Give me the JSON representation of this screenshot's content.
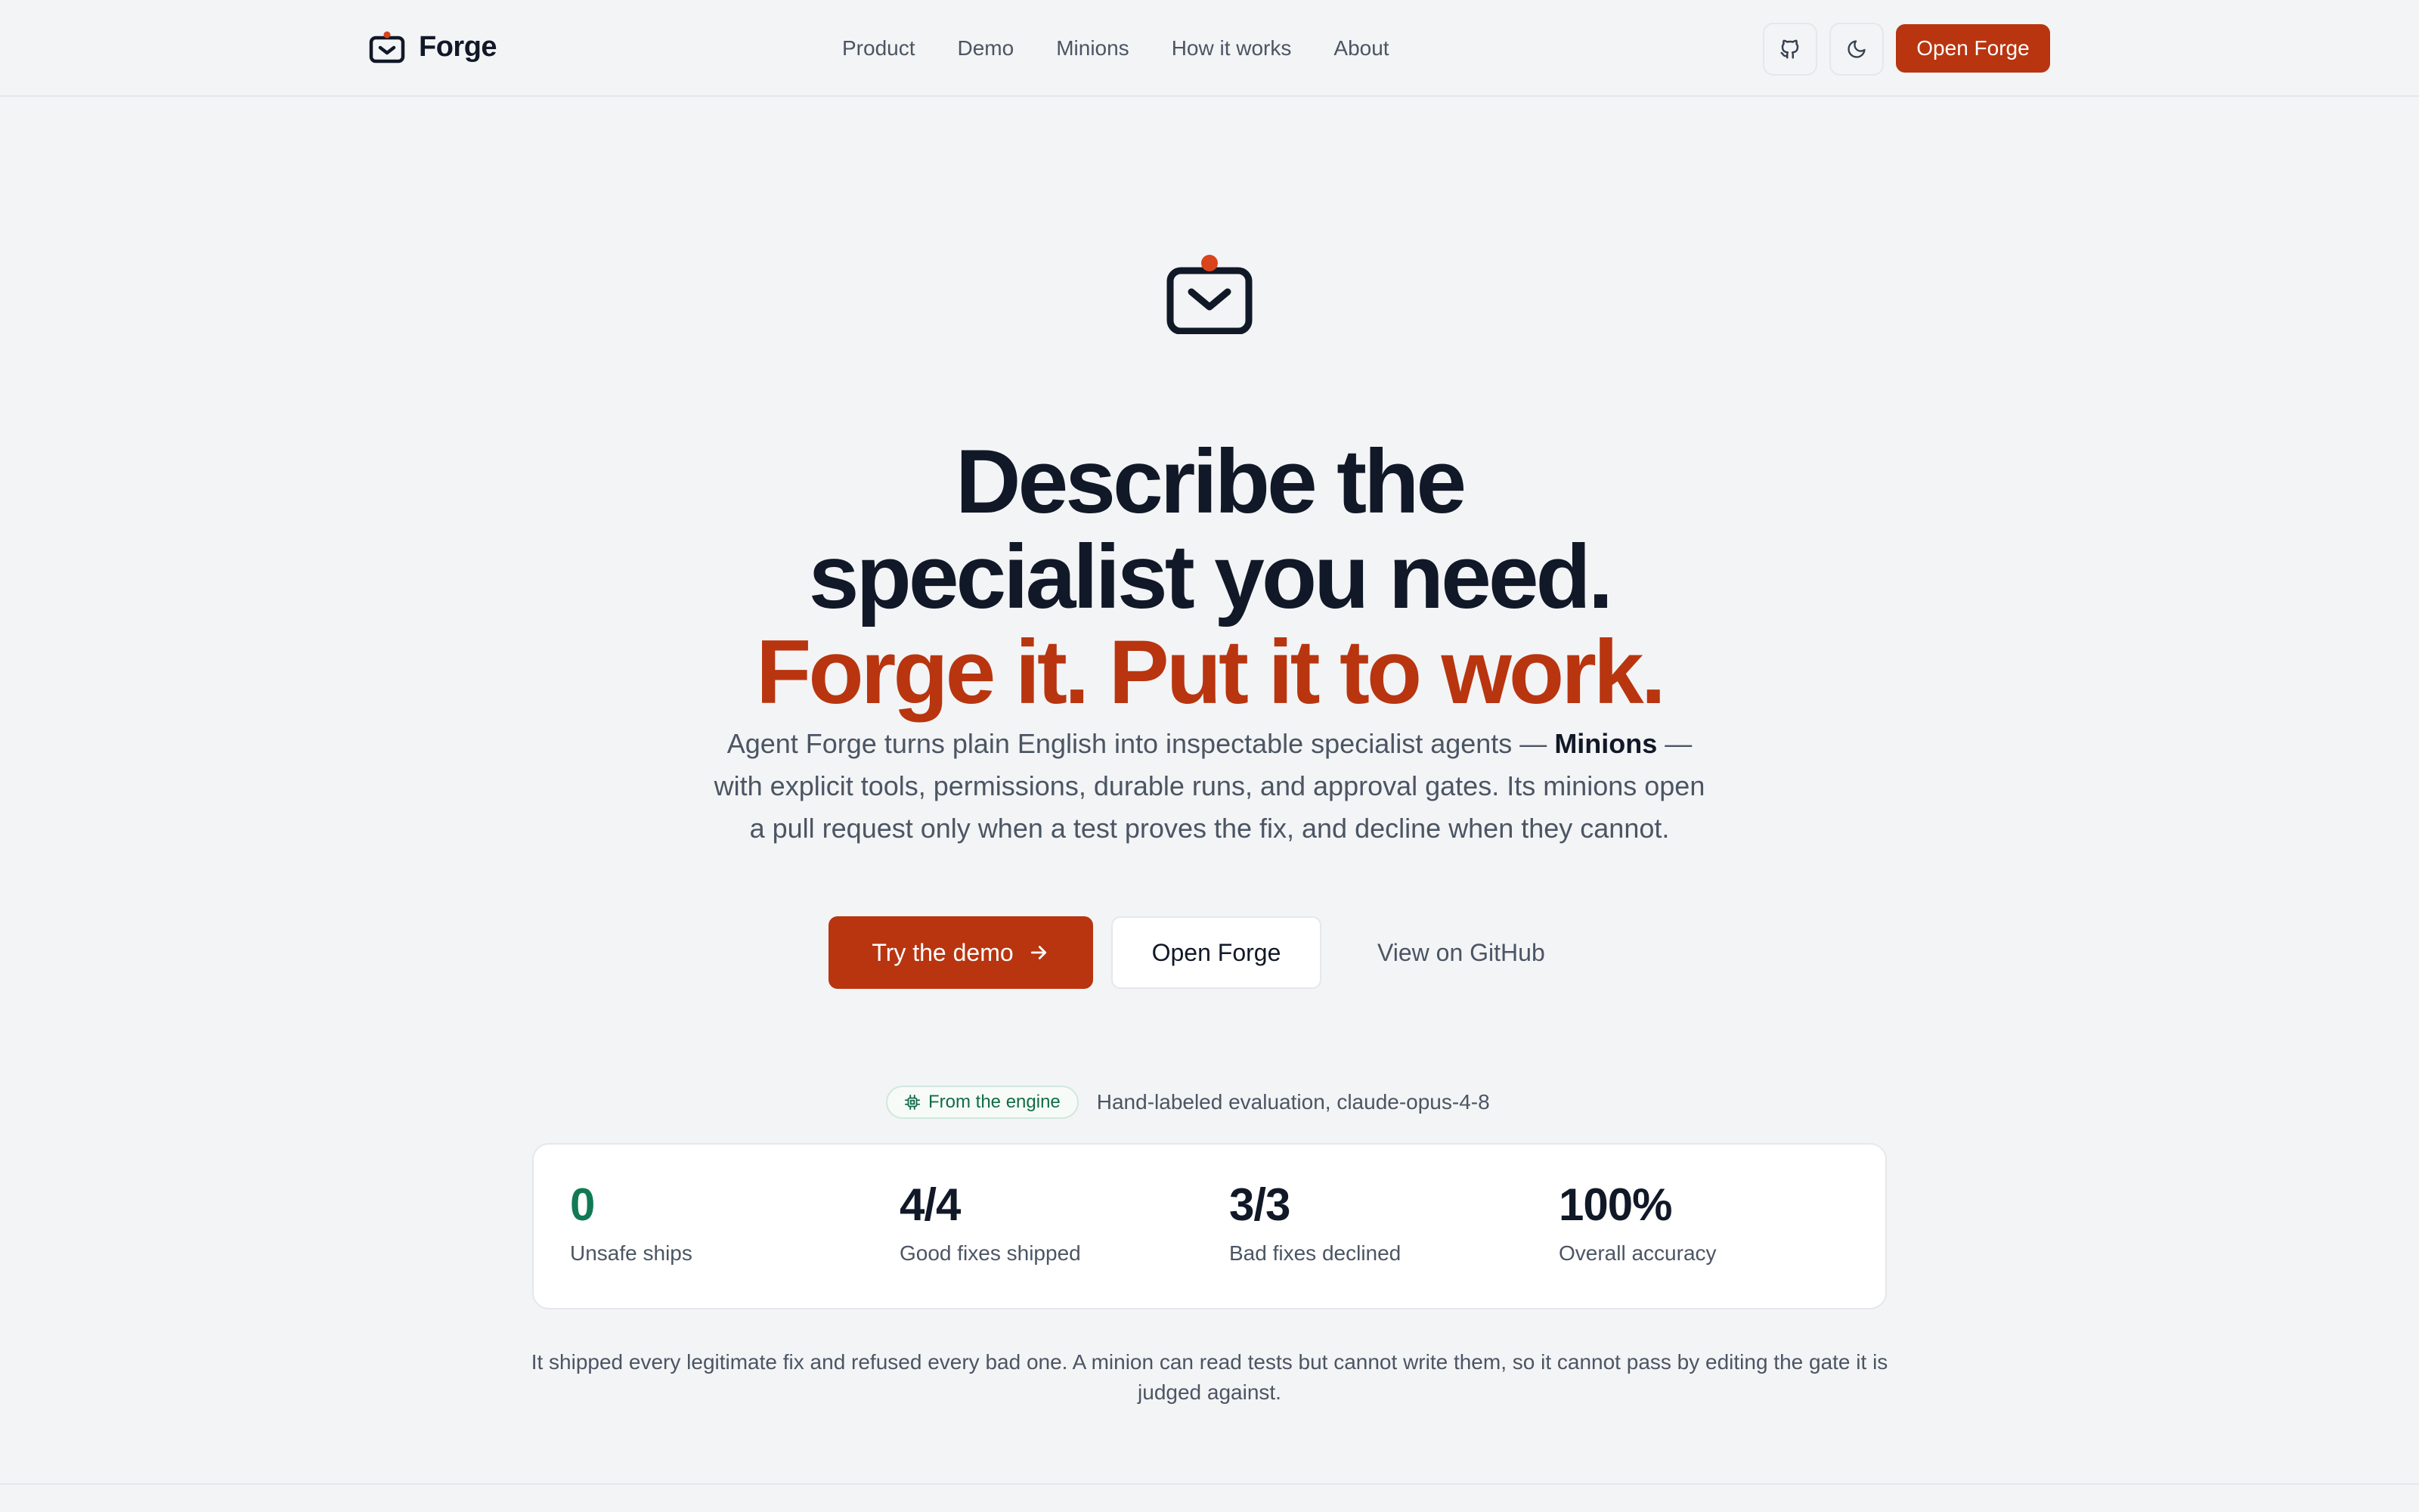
{
  "header": {
    "brand": "Forge",
    "nav": [
      "Product",
      "Demo",
      "Minions",
      "How it works",
      "About"
    ],
    "icons": [
      "github-icon",
      "moon-icon"
    ],
    "cta": "Open Forge"
  },
  "hero": {
    "headline_line1": "Describe the",
    "headline_line2": "specialist you need.",
    "headline_accent": "Forge it. Put it to work.",
    "sub_before": "Agent Forge turns plain English into inspectable specialist agents — ",
    "sub_bold": "Minions",
    "sub_after": " — with explicit tools, permissions, durable runs, and approval gates. Its minions open a pull request only when a test proves the fix, and decline when they cannot.",
    "primary_cta": "Try the demo",
    "secondary_cta": "Open Forge",
    "tertiary_cta": "View on GitHub"
  },
  "engine": {
    "badge": "From the engine",
    "note": "Hand-labeled evaluation, claude-opus-4-8",
    "stats": [
      {
        "value": "0",
        "label": "Unsafe ships"
      },
      {
        "value": "4/4",
        "label": "Good fixes shipped"
      },
      {
        "value": "3/3",
        "label": "Bad fixes declined"
      },
      {
        "value": "100%",
        "label": "Overall accuracy"
      }
    ],
    "footnote": "It shipped every legitimate fix and refused every bad one. A minion can read tests but cannot write them, so it cannot pass by editing the gate it is judged against."
  },
  "colors": {
    "accent": "#b8350f",
    "success": "#117a55",
    "background": "#f3f4f6"
  }
}
